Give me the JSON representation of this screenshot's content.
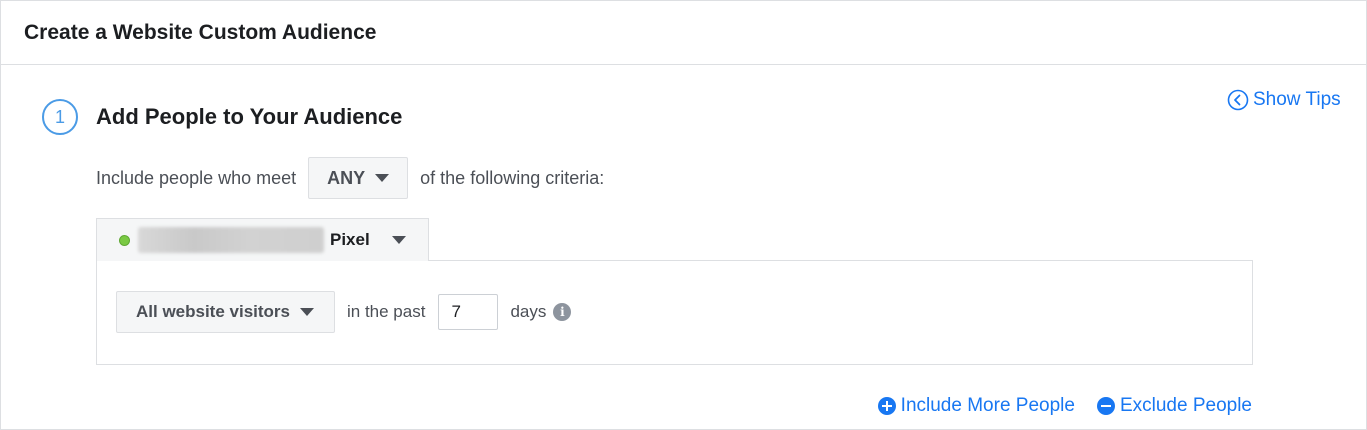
{
  "header": {
    "title": "Create a Website Custom Audience"
  },
  "tips": {
    "label": "Show Tips",
    "icon": "chevron-left-circle-icon"
  },
  "step": {
    "number": "1",
    "title": "Add People to Your Audience"
  },
  "criteria": {
    "prefix": "Include people who meet",
    "match_value": "ANY",
    "suffix": "of the following criteria:"
  },
  "pixel": {
    "status_color": "#7ac943",
    "label": "Pixel"
  },
  "rule": {
    "visitors_option": "All website visitors",
    "in_the_past_label": "in the past",
    "days_value": "7",
    "days_label": "days",
    "info_icon": "i"
  },
  "actions": {
    "include_label": "Include More People",
    "exclude_label": "Exclude People"
  },
  "colors": {
    "accent": "#1877f2",
    "step_circle": "#4b9be6"
  }
}
